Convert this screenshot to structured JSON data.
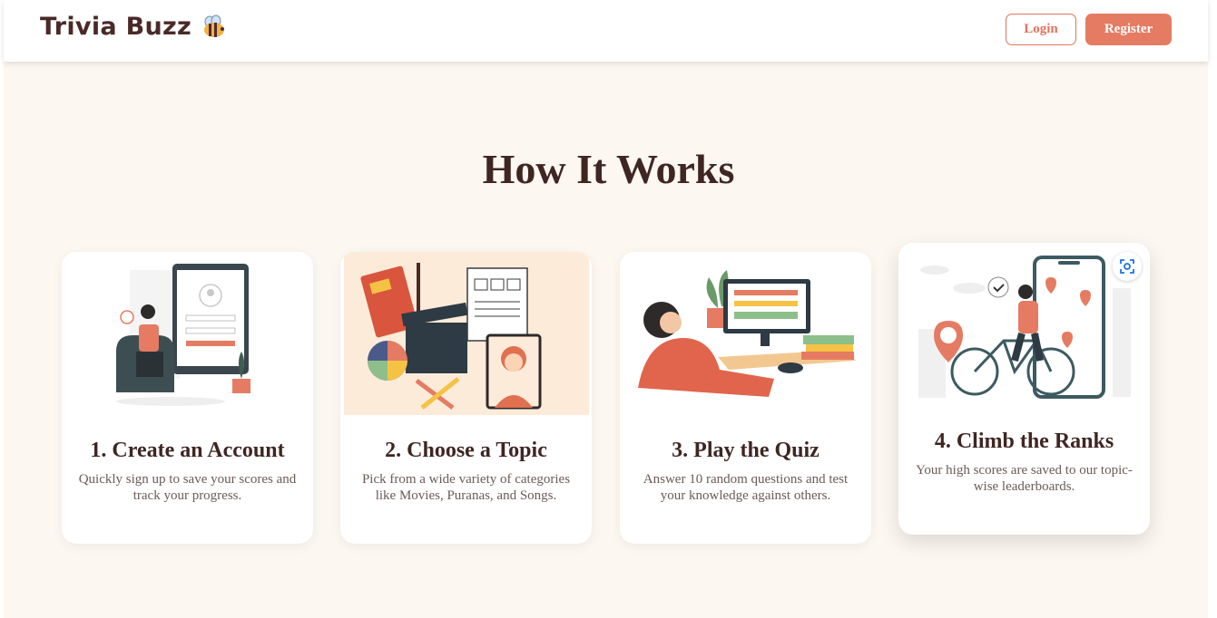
{
  "brand": {
    "name": "Trivia Buzz",
    "icon": "bee-icon"
  },
  "nav": {
    "login_label": "Login",
    "register_label": "Register"
  },
  "section": {
    "heading": "How It Works"
  },
  "colors": {
    "accent": "#e57b62",
    "heading": "#3f2622",
    "background": "#fcf7f0"
  },
  "steps": [
    {
      "title": "1. Create an Account",
      "description": "Quickly sign up to save your scores and track your progress.",
      "illustration": "signup-illustration"
    },
    {
      "title": "2. Choose a Topic",
      "description": "Pick from a wide variety of categories like Movies, Puranas, and Songs.",
      "illustration": "topics-illustration"
    },
    {
      "title": "3. Play the Quiz",
      "description": "Answer 10 random questions and test your knowledge against others.",
      "illustration": "quiz-illustration"
    },
    {
      "title": "4. Climb the Ranks",
      "description": "Your high scores are saved to our topic-wise leaderboards.",
      "illustration": "leaderboard-illustration"
    }
  ]
}
